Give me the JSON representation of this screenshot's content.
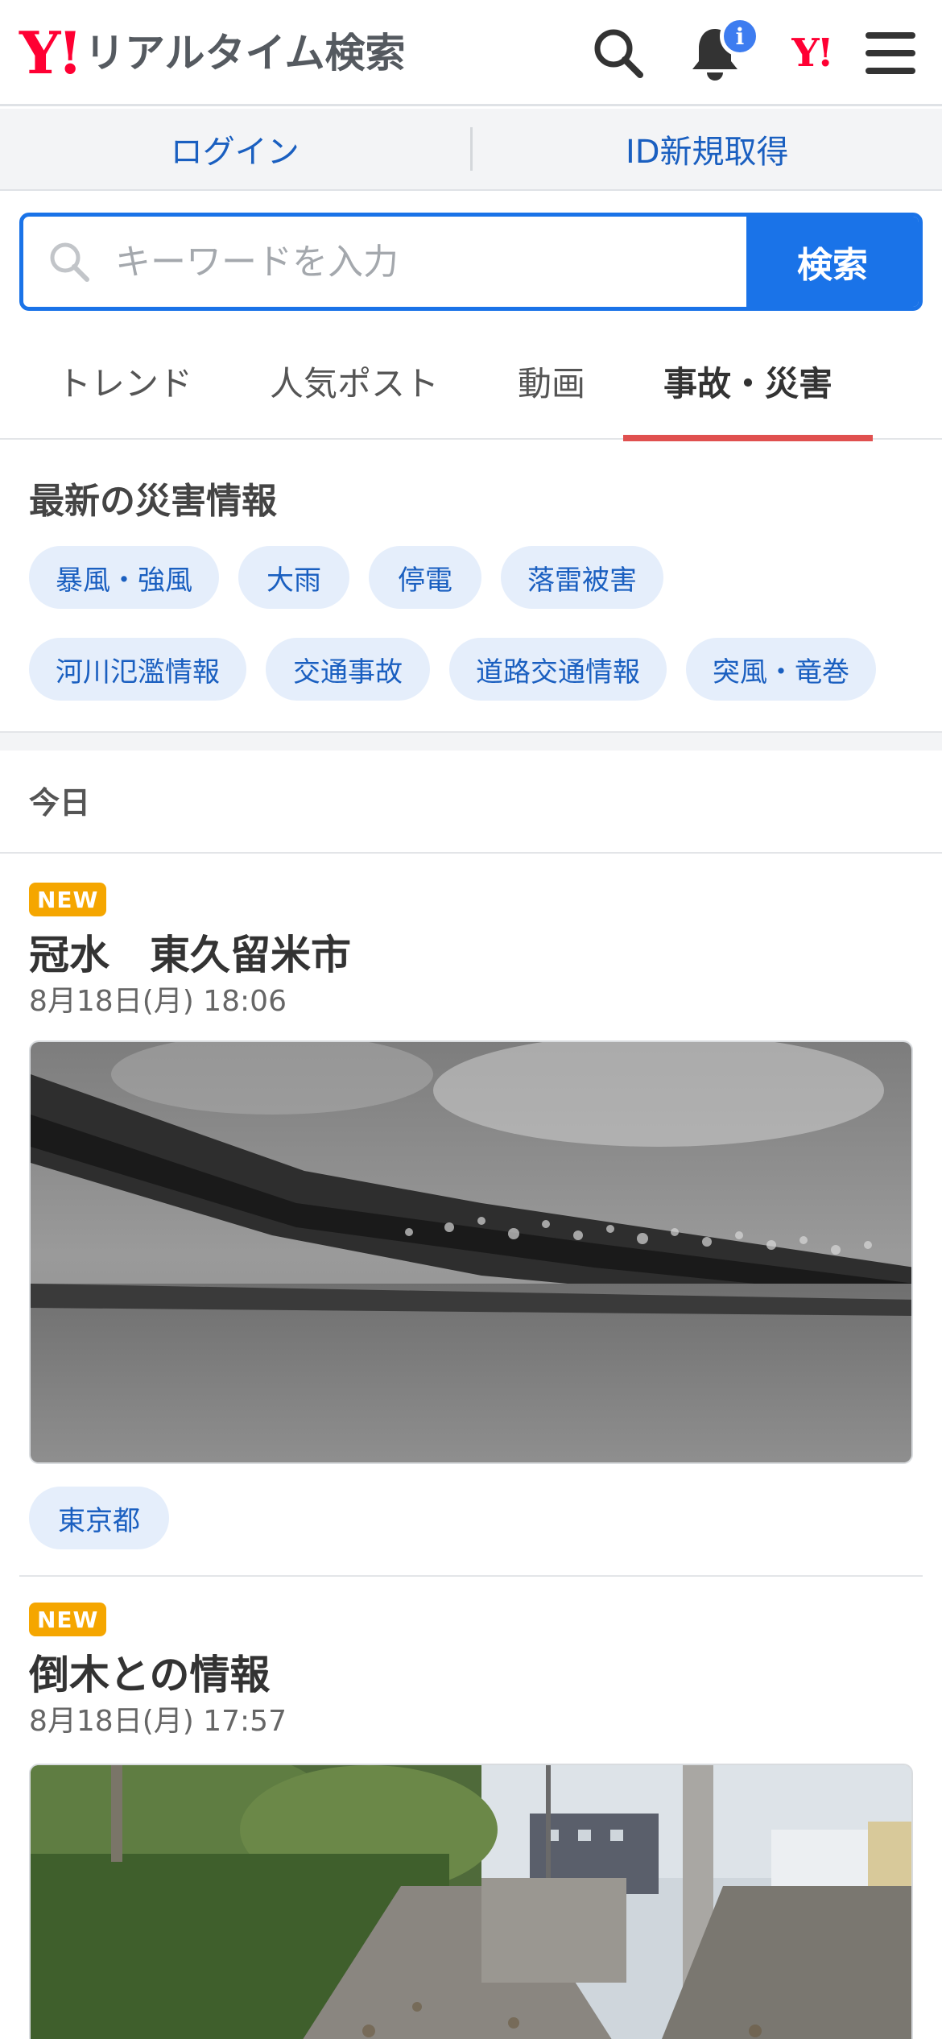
{
  "header": {
    "logo_mark": "Y!",
    "logo_text": "リアルタイム検索",
    "notification_badge": "i",
    "yj_mark": "Y!",
    "icons": [
      "search-icon",
      "bell-icon",
      "yahoo-japan-logo",
      "menu-icon"
    ]
  },
  "auth": {
    "login_label": "ログイン",
    "register_label": "ID新規取得"
  },
  "search": {
    "placeholder": "キーワードを入力",
    "button_label": "検索"
  },
  "tabs": [
    {
      "label": "トレンド",
      "active": false
    },
    {
      "label": "人気ポスト",
      "active": false
    },
    {
      "label": "動画",
      "active": false
    },
    {
      "label": "事故・災害",
      "active": true
    }
  ],
  "disaster": {
    "title": "最新の災害情報",
    "chips": [
      "暴風・強風",
      "大雨",
      "停電",
      "落雷被害",
      "河川氾濫情報",
      "交通事故",
      "道路交通情報",
      "突風・竜巻"
    ]
  },
  "day_label": "今日",
  "posts": [
    {
      "badge": "NEW",
      "title": "冠水　東久留米市",
      "date": "8月18日(月) 18:06",
      "location": "東京都"
    },
    {
      "badge": "NEW",
      "title": "倒木との情報",
      "date": "8月18日(月) 17:57"
    }
  ],
  "colors": {
    "brand_red": "#ff0033",
    "accent_blue": "#1a73e8",
    "link_blue": "#1a5fc0",
    "chip_bg": "#e5eefb",
    "new_badge": "#f5a600",
    "active_tab_underline": "#e0504f",
    "badge_blue": "#3d7cf0"
  }
}
